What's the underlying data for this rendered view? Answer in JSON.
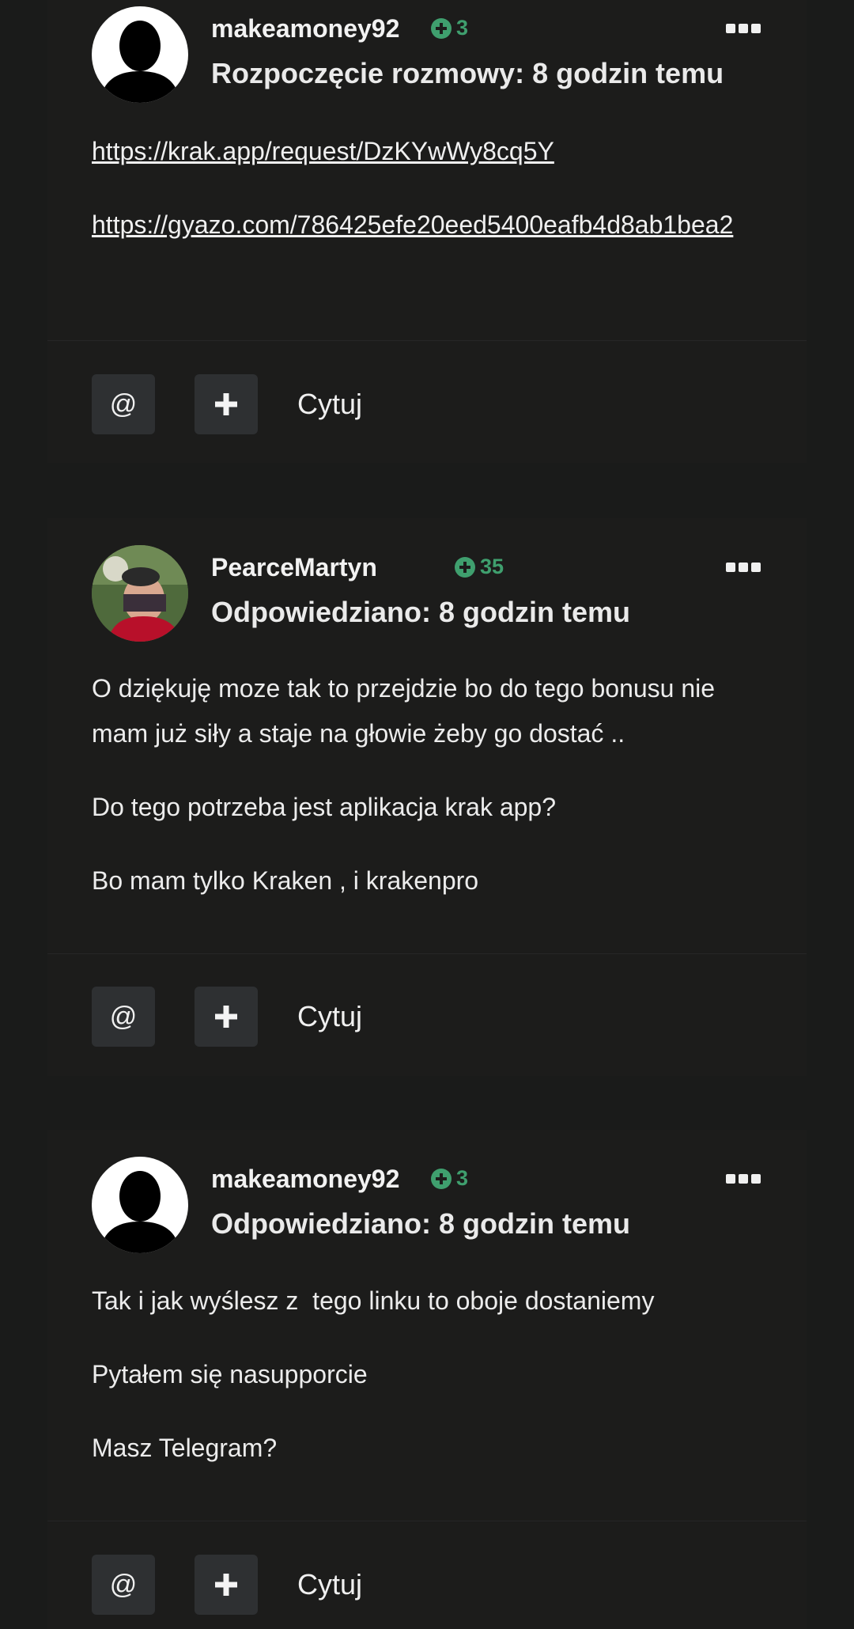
{
  "posts": [
    {
      "author": "makeamoney92",
      "reputation": "3",
      "meta": "Rozpoczęcie rozmowy: 8 godzin temu",
      "links": [
        "https://krak.app/request/DzKYwWy8cq5Y",
        "https://gyazo.com/786425efe20eed5400eafb4d8ab1bea2"
      ],
      "actions": {
        "mention": "@",
        "quote": "Cytuj"
      }
    },
    {
      "author": "PearceMartyn",
      "reputation": "35",
      "meta": "Odpowiedziano: 8 godzin temu",
      "paragraphs": [
        "O dziękuję moze tak to przejdzie bo do tego bonusu nie mam już siły a staje na głowie żeby go dostać ..",
        "Do tego potrzeba jest aplikacja krak app?",
        "Bo mam tylko Kraken , i krakenpro"
      ],
      "actions": {
        "mention": "@",
        "quote": "Cytuj"
      }
    },
    {
      "author": "makeamoney92",
      "reputation": "3",
      "meta": "Odpowiedziano: 8 godzin temu",
      "paragraphs": [
        "Tak i jak wyślesz z  tego linku to oboje dostaniemy",
        "Pytałem się nasupporcie",
        "Masz Telegram?"
      ],
      "actions": {
        "mention": "@",
        "quote": "Cytuj"
      }
    }
  ],
  "colors": {
    "background": "#1a1b1a",
    "reputation": "#3f9f6e",
    "button": "#2e3032"
  }
}
